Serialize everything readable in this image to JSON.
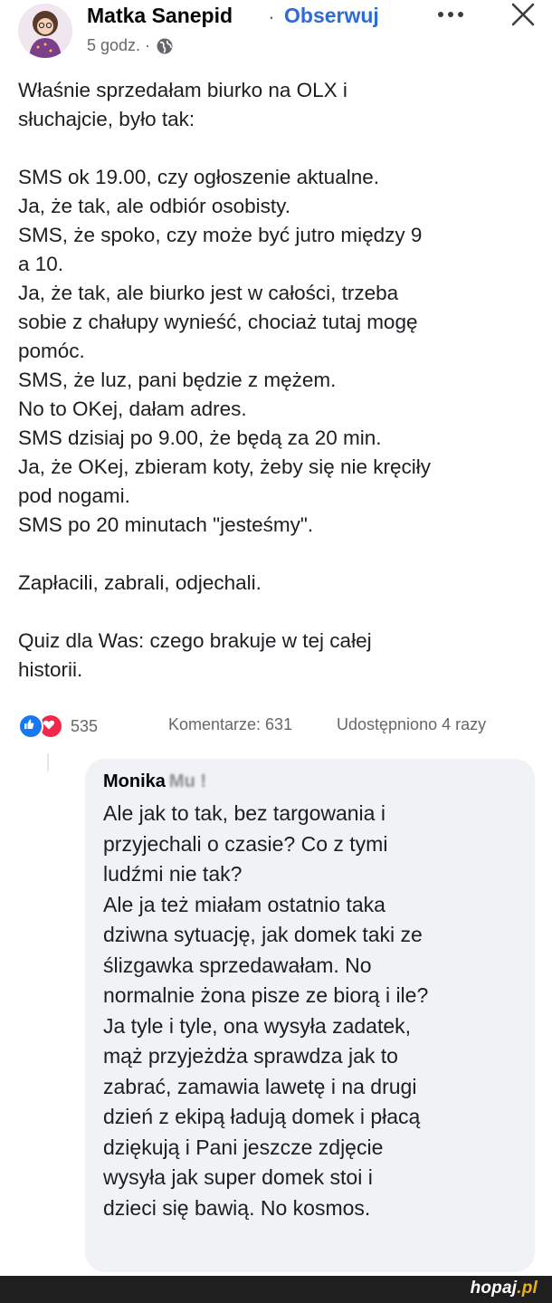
{
  "post": {
    "author": "Matka Sanepid",
    "separator": "·",
    "follow_label": "Obserwuj",
    "time": "5 godz. ·",
    "icons": {
      "audience": "globe-icon",
      "more": "more-options-icon",
      "close": "close-icon"
    },
    "paragraphs": [
      [
        "Właśnie sprzedałam biurko na OLX i",
        "słuchajcie, było tak:"
      ],
      [
        "SMS ok 19.00, czy ogłoszenie aktualne.",
        "Ja, że tak, ale odbiór osobisty.",
        "SMS, że spoko, czy może być jutro między 9",
        "a 10.",
        "Ja, że tak, ale biurko jest w całości, trzeba",
        "sobie z chałupy wynieść, chociaż tutaj mogę",
        "pomóc.",
        "SMS, że luz, pani będzie z mężem.",
        "No to OKej, dałam adres.",
        "SMS dzisiaj po 9.00, że będą za 20 min.",
        "Ja, że OKej, zbieram koty, żeby się nie kręciły",
        "pod nogami.",
        "SMS po 20 minutach \"jesteśmy\"."
      ],
      [
        "Zapłacili, zabrali, odjechali."
      ],
      [
        "Quiz dla Was: czego brakuje w tej całej",
        "historii."
      ]
    ]
  },
  "stats": {
    "reactions_count": "535",
    "comments": "Komentarze: 631",
    "shares": "Udostępniono 4 razy",
    "colors": {
      "like": "#1877f2",
      "love": "#f0284a"
    }
  },
  "comment": {
    "author": "Monika",
    "author_blurred": "Mu !",
    "lines": [
      "Ale jak to tak, bez targowania i",
      "przyjechali o czasie? Co z tymi",
      "ludźmi nie tak?",
      "Ale ja też miałam ostatnio taka",
      "dziwna sytuację, jak domek taki ze",
      "ślizgawka sprzedawałam. No",
      "normalnie żona pisze ze biorą i ile?",
      "Ja tyle i tyle, ona wysyła zadatek,",
      "mąż przyjeżdża sprawdza jak to",
      "zabrać, zamawia lawetę i na drugi",
      "dzień z ekipą ładują domek i płacą",
      "dziękują i Pani jeszcze zdjęcie",
      "wysyła jak super domek stoi i",
      "dzieci się bawią. No kosmos."
    ]
  },
  "watermark": {
    "main": "hopaj",
    "accent": ".pl"
  }
}
